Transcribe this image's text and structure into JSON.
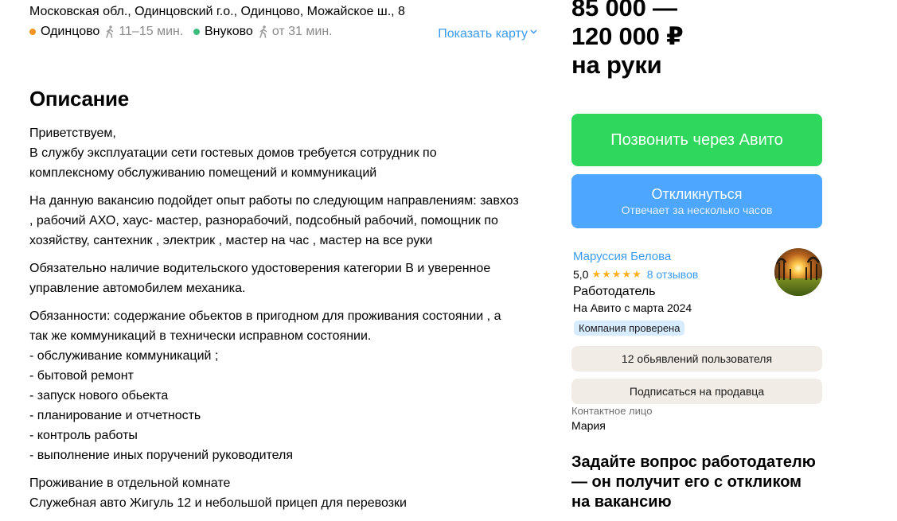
{
  "location": {
    "address": "Московская обл., Одинцовский г.о., Одинцово, Можайское ш., 8",
    "stations": [
      {
        "name": "Одинцово",
        "time": "11–15 мин.",
        "color": "#f29322",
        "icon": "walking-person-icon"
      },
      {
        "name": "Внуково",
        "time": "от 31 мин.",
        "color": "#3dbd7d",
        "icon": "walking-person-icon"
      }
    ],
    "show_map": "Показать карту"
  },
  "description": {
    "title": "Описание",
    "paragraphs": [
      [
        "Приветствуем,",
        "В службу эксплуатации сети гостевых домов требуется сотрудник по",
        "комплексному обслуживанию помещений и коммуникаций"
      ],
      [
        "На данную вакансию подойдет опыт работы по следующим направлениям: завхоз",
        ", рабочий АХО, хаус- мастер, разнорабочий, подсобный рабочий, помощник по",
        "хозяйству, сантехник , электрик , мастер на час , мастер на все руки"
      ],
      [
        "Обязательно наличие водительского удостоверения категории В и уверенное",
        "управление автомобилем механика."
      ],
      [
        "Обязанности: содержание обьектов в пригодном для проживания состоянии , а",
        "так же коммуникаций в технически исправном состоянии.",
        "- обслуживание коммуникаций ;",
        "- бытовой ремонт",
        "- запуск нового обьекта",
        "- планирование и отчетность",
        "- контроль работы",
        "- выполнение иных поручений руководителя"
      ],
      [
        "Проживание в отдельной комнате",
        "Служебная авто Жигуль 12 и небольшой прицеп для перевозки"
      ]
    ]
  },
  "salary": {
    "line1": "85 000 —",
    "line2": "120 000 ₽",
    "line3": "на руки"
  },
  "actions": {
    "call_label": "Позвонить через Авито",
    "respond_label": "Откликнуться",
    "respond_sub": "Отвечает за несколько часов",
    "call_color": "#2fd85c",
    "respond_color": "#4da6ff"
  },
  "seller": {
    "name": "Маруссия Белова",
    "rating": "5,0",
    "stars": 5,
    "reviews": "8 отзывов",
    "role": "Работодатель",
    "since": "На Авито с марта 2024",
    "badge": "Компания проверена",
    "ads_button": "12 обьявлений пользователя",
    "subscribe_button": "Подписаться на продавца",
    "contact_label": "Контактное лицо",
    "contact_name": "Мария"
  },
  "ask": {
    "text": "Задайте вопрос работодателю — он получит его с откликом на вакансию"
  }
}
